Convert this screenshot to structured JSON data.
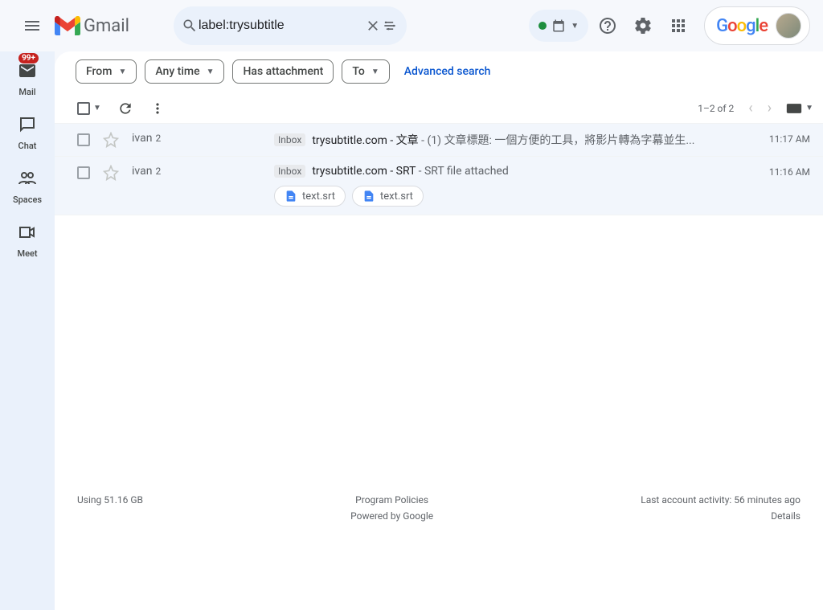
{
  "header": {
    "app_name": "Gmail",
    "search_value": "label:trysubtitle",
    "badge_count": "99+"
  },
  "nav": {
    "mail": "Mail",
    "chat": "Chat",
    "spaces": "Spaces",
    "meet": "Meet"
  },
  "filters": {
    "from": "From",
    "any_time": "Any time",
    "has_attachment": "Has attachment",
    "to": "To",
    "advanced": "Advanced search"
  },
  "toolbar": {
    "page_info": "1–2 of 2"
  },
  "emails": [
    {
      "sender": "ivan",
      "count": "2",
      "label": "Inbox",
      "subject_strong": "trysubtitle.com - 文章",
      "subject_rest": " - (1) 文章標題: 一個方便的工具，將影片轉為字幕並生...",
      "time": "11:17 AM",
      "attachments": []
    },
    {
      "sender": "ivan",
      "count": "2",
      "label": "Inbox",
      "subject_strong": "trysubtitle.com - SRT",
      "subject_rest": " - SRT file attached",
      "time": "11:16 AM",
      "attachments": [
        "text.srt",
        "text.srt"
      ]
    }
  ],
  "footer": {
    "storage": "Using 51.16 GB",
    "policies": "Program Policies",
    "powered": "Powered by Google",
    "activity": "Last account activity: 56 minutes ago",
    "details": "Details"
  }
}
